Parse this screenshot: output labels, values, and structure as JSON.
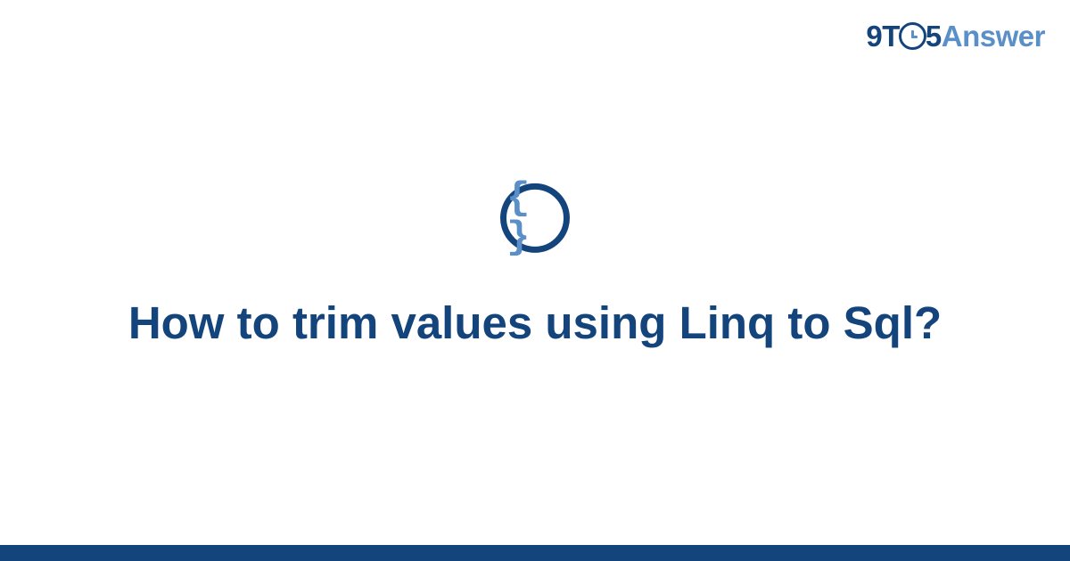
{
  "header": {
    "logo": {
      "part1": "9T",
      "part2": "5",
      "part3": "Answer"
    }
  },
  "main": {
    "icon_glyph": "{ }",
    "title": "How to trim values using Linq to Sql?"
  },
  "colors": {
    "dark_blue": "#14447c",
    "light_blue": "#5a8fc8"
  }
}
